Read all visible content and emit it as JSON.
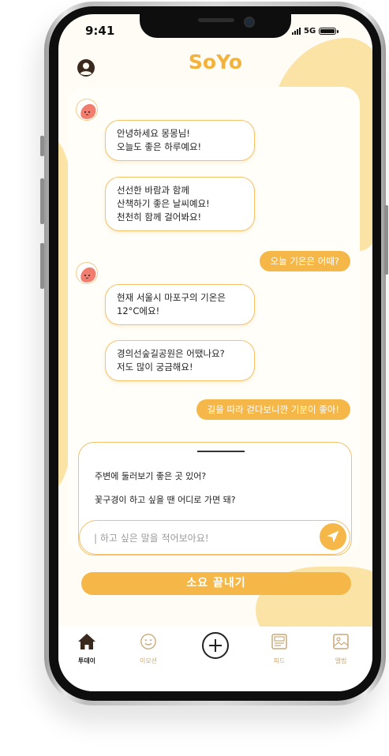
{
  "status_bar": {
    "time": "9:41",
    "network": "5G"
  },
  "header": {
    "logo": "SoYo"
  },
  "chat": {
    "messages": [
      {
        "from": "bot",
        "lines": [
          "안녕하세요 몽몽님!",
          "오늘도 좋은 하루예요!"
        ]
      },
      {
        "from": "bot",
        "lines": [
          "선선한 바람과 함께",
          "산책하기 좋은 날씨예요!",
          "천천히 함께 걸어봐요!"
        ]
      },
      {
        "from": "user",
        "text": "오늘 기온은 어때?"
      },
      {
        "from": "bot",
        "lines": [
          "현재 서울시 마포구의 기온은",
          "12°C에요!"
        ]
      },
      {
        "from": "bot",
        "lines": [
          "경의선숲길공원은 어땠나요?",
          "저도 많이 궁금해요!"
        ]
      },
      {
        "from": "user",
        "text": "길을 따라 걷다보니깐 기분이 좋아!"
      }
    ]
  },
  "suggestions": [
    "주변에 둘러보기 좋은 곳 있어?",
    "꽃구경이 하고 싶을 땐 어디로 가면 돼?"
  ],
  "input": {
    "placeholder": "| 하고 싶은 말을 적어보아요!"
  },
  "end_button": {
    "label": "소요 끝내기"
  },
  "bottom_nav": {
    "items": [
      {
        "label": "투데이",
        "icon": "home-icon",
        "active": true
      },
      {
        "label": "이모션",
        "icon": "smiley-icon",
        "active": false
      },
      {
        "label": "",
        "icon": "plus-circle-icon",
        "active": false
      },
      {
        "label": "피드",
        "icon": "feed-icon",
        "active": false
      },
      {
        "label": "앨범",
        "icon": "image-icon",
        "active": false
      }
    ]
  },
  "colors": {
    "accent": "#f5b848",
    "border": "#f5c169",
    "blob": "#fbe3a6",
    "logo": "#f3b23b"
  }
}
